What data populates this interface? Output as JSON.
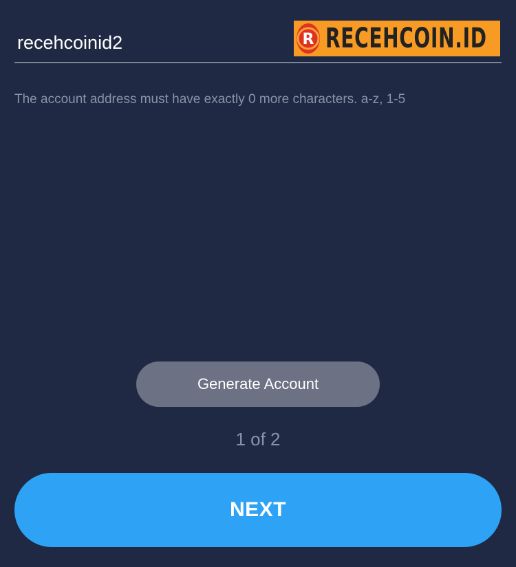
{
  "account": {
    "input_value": "recehcoinid2",
    "hint": "The account address must have exactly 0 more characters. a-z, 1-5"
  },
  "watermark": {
    "logo_letter": "R",
    "text": "RECEHCOIN.ID",
    "bg_color": "#f89b25",
    "logo_color": "#e0321e"
  },
  "actions": {
    "generate_label": "Generate Account",
    "step_counter": "1 of 2",
    "next_label": "NEXT"
  },
  "colors": {
    "background": "#1f2943",
    "primary": "#2ea3f5",
    "secondary_button": "#6c7283",
    "muted_text": "#8a93a8"
  }
}
